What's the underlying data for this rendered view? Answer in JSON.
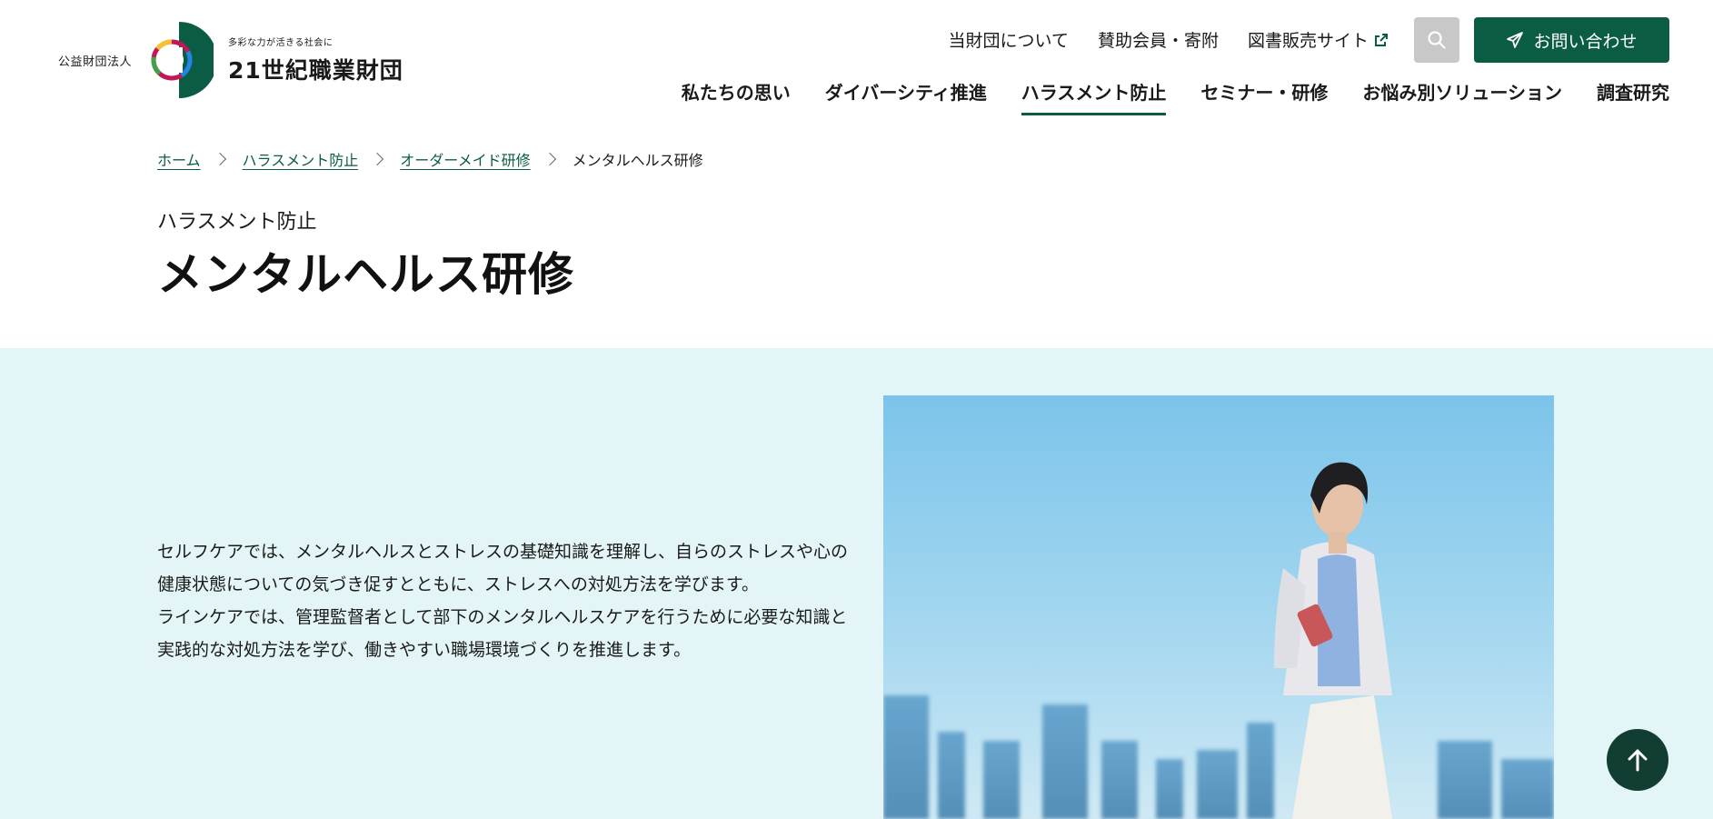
{
  "header": {
    "logo": {
      "corp_type": "公益財団法人",
      "tagline": "多彩な力が活きる社会に",
      "name": "21世紀職業財団"
    },
    "util_links": [
      {
        "label": "当財団について"
      },
      {
        "label": "賛助会員・寄附"
      },
      {
        "label": "図書販売サイト",
        "icon": "external-link-icon"
      }
    ],
    "search_icon": "search-icon",
    "contact_label": "お問い合わせ",
    "contact_icon": "paper-plane-icon",
    "nav": [
      {
        "label": "私たちの思い"
      },
      {
        "label": "ダイバーシティ推進"
      },
      {
        "label": "ハラスメント防止",
        "active": true
      },
      {
        "label": "セミナー・研修"
      },
      {
        "label": "お悩み別ソリューション"
      },
      {
        "label": "調査研究"
      }
    ]
  },
  "breadcrumb": [
    {
      "label": "ホーム"
    },
    {
      "label": "ハラスメント防止"
    },
    {
      "label": "オーダーメイド研修"
    },
    {
      "label": "メンタルヘルス研修"
    }
  ],
  "page": {
    "category": "ハラスメント防止",
    "title": "メンタルヘルス研修"
  },
  "hero": {
    "paragraphs": [
      "セルフケアでは、メンタルヘルスとストレスの基礎知識を理解し、自らのストレスや心の健康状態についての気づき促すとともに、ストレスへの対処方法を学びます。",
      "ラインケアでは、管理監督者として部下のメンタルヘルスケアを行うために必要な知識と実践的な対処方法を学び、働きやすい職場環境づくりを推進します。"
    ],
    "image": "woman-walking-city-skyline-photo"
  },
  "back_to_top_icon": "arrow-up-icon",
  "colors": {
    "brand_green": "#0b5c45",
    "hero_bg": "#e3f5f6",
    "top_button": "#123d33",
    "search_button": "#c8c8c8"
  }
}
